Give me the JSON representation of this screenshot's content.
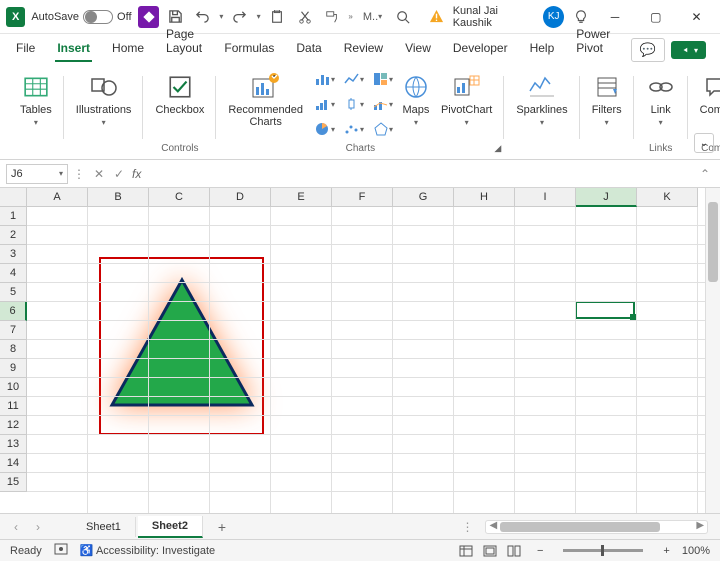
{
  "title_bar": {
    "app_letter": "X",
    "autosave_label": "AutoSave",
    "autosave_state": "Off",
    "doc_short": "M..",
    "user_name": "Kunal Jai Kaushik",
    "user_initials": "KJ"
  },
  "tabs": {
    "items": [
      "File",
      "Insert",
      "Home",
      "Page Layout",
      "Formulas",
      "Data",
      "Review",
      "View",
      "Developer",
      "Help",
      "Power Pivot"
    ],
    "active_index": 1
  },
  "ribbon": {
    "tables": "Tables",
    "illustrations": "Illustrations",
    "checkbox": "Checkbox",
    "controls_group": "Controls",
    "recommended_charts": "Recommended\nCharts",
    "charts_group": "Charts",
    "maps": "Maps",
    "pivotchart": "PivotChart",
    "sparklines": "Sparklines",
    "filters": "Filters",
    "link": "Link",
    "links_group": "Links",
    "comment": "Comm",
    "comment_group": "Comm"
  },
  "formula_bar": {
    "name_box": "J6",
    "fx_label": "fx",
    "value": ""
  },
  "grid": {
    "columns": [
      "A",
      "B",
      "C",
      "D",
      "E",
      "F",
      "G",
      "H",
      "I",
      "J",
      "K"
    ],
    "rows": [
      "1",
      "2",
      "3",
      "4",
      "5",
      "6",
      "7",
      "8",
      "9",
      "10",
      "11",
      "12",
      "13",
      "14",
      "15"
    ],
    "sel_col_index": 9,
    "sel_row_index": 5,
    "sel_name": "J6"
  },
  "sheets": {
    "tabs": [
      "Sheet1",
      "Sheet2"
    ],
    "active_index": 1
  },
  "status": {
    "ready": "Ready",
    "accessibility": "Accessibility: Investigate",
    "zoom": "100%"
  },
  "shape": {
    "type": "triangle",
    "fill": "#23a84a",
    "stroke": "#0a2a5e",
    "glow_color": "#ff9e6e"
  }
}
